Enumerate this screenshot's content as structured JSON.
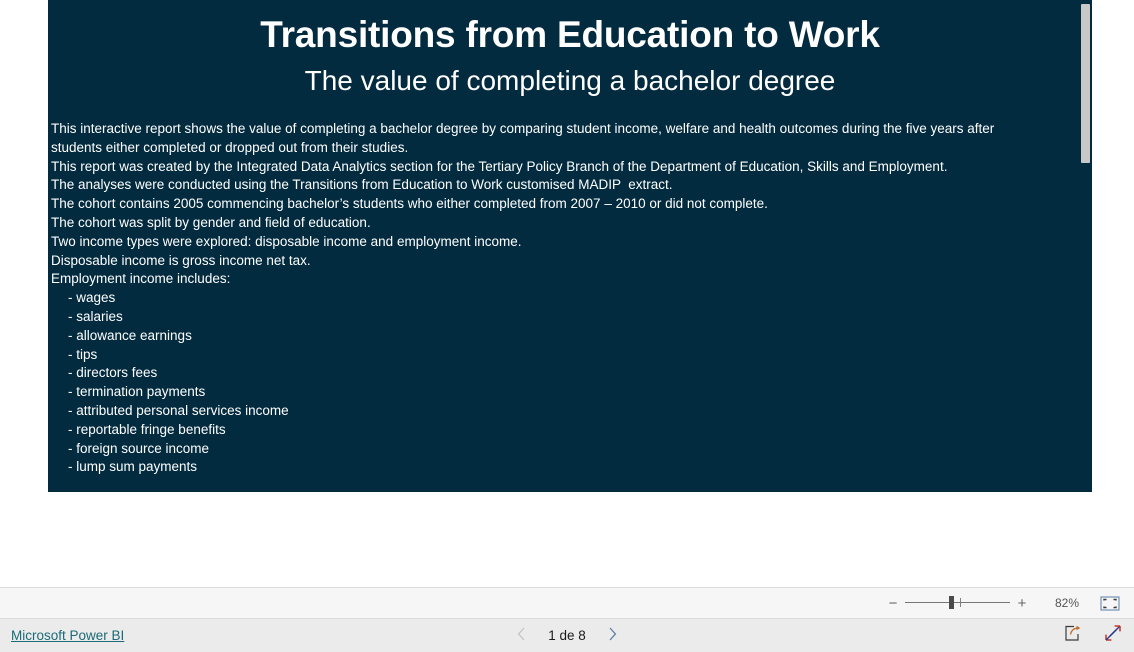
{
  "report": {
    "title": "Transitions from Education to Work",
    "subtitle": "The value of completing a bachelor degree",
    "background_color": "#032b3f",
    "text_color": "#ffffff",
    "body_lines": [
      "This interactive report shows the value of completing a bachelor degree by comparing student income, welfare and health outcomes during the five years after students either completed or dropped out from their studies.",
      "This report was created by the Integrated Data Analytics section for the Tertiary Policy Branch of the Department of Education, Skills and Employment.",
      "The analyses were conducted using the Transitions from Education to Work customised MADIP  extract.",
      "The cohort contains 2005 commencing bachelor’s students who either completed from 2007 – 2010 or did not complete.",
      "The cohort was split by gender and field of education.",
      "Two income types were explored: disposable income and employment income.",
      "Disposable income is gross income net tax.",
      "Employment income includes:"
    ],
    "bullet_items": [
      "- wages",
      "- salaries",
      "- allowance earnings",
      "- tips",
      "- directors fees",
      "- termination payments",
      "- attributed personal services income",
      "- reportable fringe benefits",
      "- foreign source income",
      "- lump sum payments"
    ]
  },
  "toolbar": {
    "zoom_out_label": "−",
    "zoom_in_label": "+",
    "zoom_percent": "82%",
    "fit_to_page_icon": "fit-to-page-icon"
  },
  "status_bar": {
    "brand_link": "Microsoft Power BI",
    "brand_link_color": "#1a6b77",
    "prev_page_icon": "chevron-left-icon",
    "next_page_icon": "chevron-right-icon",
    "page_indicator": "1 de 8",
    "share_icon": "share-icon",
    "fullscreen_icon": "fullscreen-icon"
  }
}
